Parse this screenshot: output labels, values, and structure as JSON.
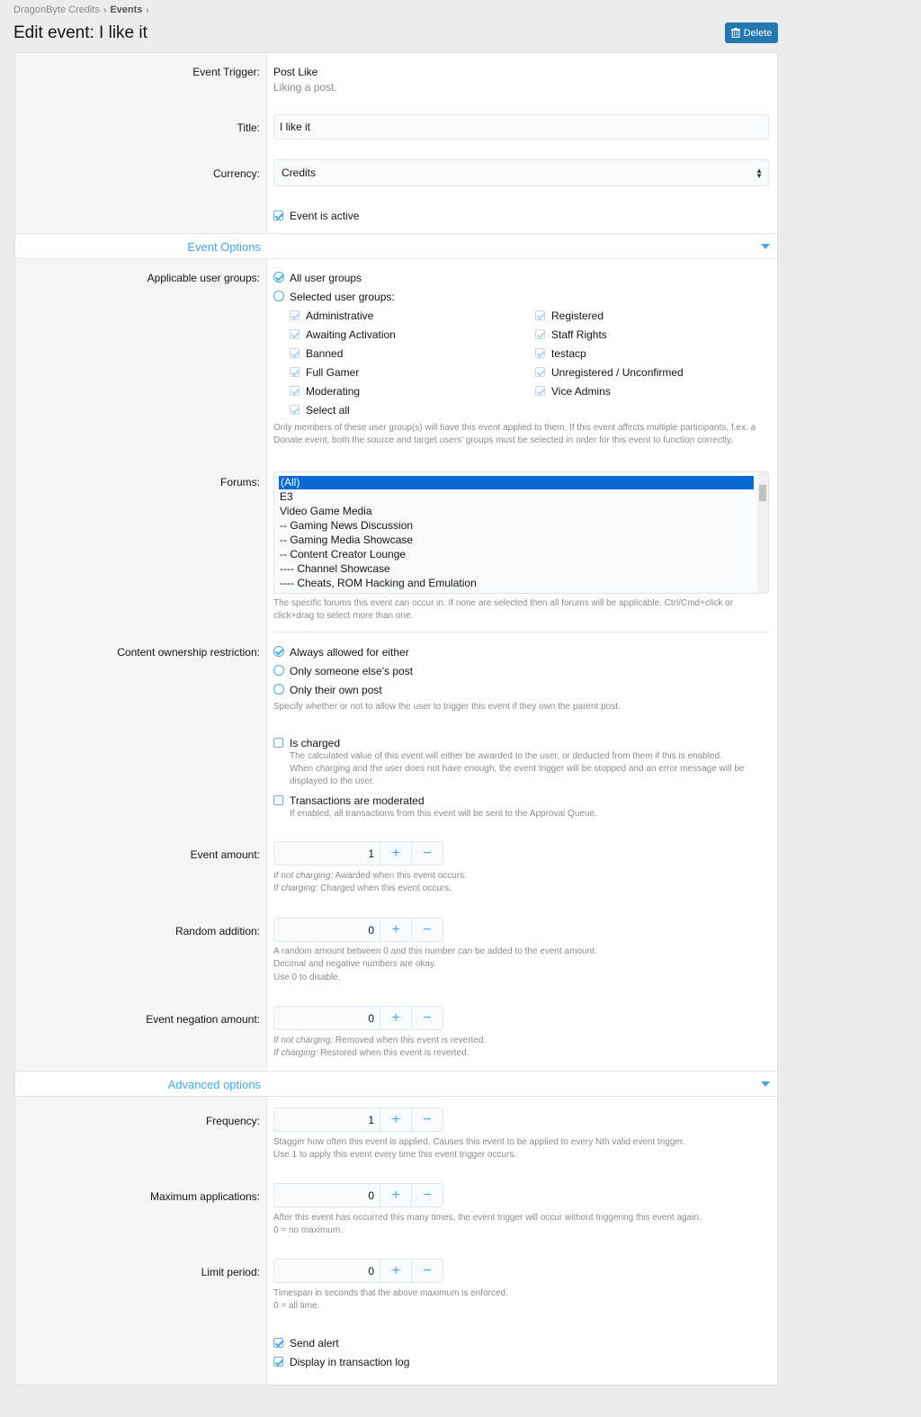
{
  "breadcrumb": {
    "root": "DragonByte Credits",
    "current": "Events"
  },
  "page_title": "Edit event: I like it",
  "delete_label": "Delete",
  "event_trigger": {
    "label": "Event Trigger:",
    "value": "Post Like",
    "desc": "Liking a post."
  },
  "title": {
    "label": "Title:",
    "value": "I like it"
  },
  "currency": {
    "label": "Currency:",
    "value": "Credits"
  },
  "event_active": {
    "label": "Event is active",
    "checked": true
  },
  "section_event_options": "Event Options",
  "user_groups": {
    "label": "Applicable user groups:",
    "all_label": "All user groups",
    "selected_label": "Selected user groups:",
    "col1": [
      "Administrative",
      "Awaiting Activation",
      "Banned",
      "Full Gamer",
      "Moderating",
      "Select all"
    ],
    "col2": [
      "Registered",
      "Staff Rights",
      "testacp",
      "Unregistered / Unconfirmed",
      "Vice Admins"
    ],
    "hint1": "Only members of these user group(s) will have this event applied to them. If this event affects multiple participants, f.ex. a",
    "hint2": "Donate event, both the source and target users' groups must be selected in order for this event to function correctly."
  },
  "forums": {
    "label": "Forums:",
    "options": [
      "(All)",
      "E3",
      "Video Game Media",
      "-- Gaming News Discussion",
      "-- Gaming Media Showcase",
      "-- Content Creator Lounge",
      "---- Channel Showcase",
      "---- Cheats, ROM Hacking and Emulation"
    ],
    "selected": "(All)",
    "hint1": "The specific forums this event can occur in. If none are selected then all forums will be applicable. Ctrl/Cmd+click or",
    "hint2": "click+drag to select more than one."
  },
  "ownership": {
    "label": "Content ownership restriction:",
    "options": [
      "Always allowed for either",
      "Only someone else's post",
      "Only their own post"
    ],
    "selected": "Always allowed for either",
    "hint": "Specify whether or not to allow the user to trigger this event if they own the parent post."
  },
  "is_charged": {
    "label": "Is charged",
    "checked": false,
    "hint1": "The calculated value of this event will either be awarded to the user, or deducted from them if this is enabled.",
    "hint2": "When charging and the user does not have enough, the event trigger will be stopped and an error message will be",
    "hint3": "displayed to the user."
  },
  "moderated": {
    "label": "Transactions are moderated",
    "checked": false,
    "hint": "If enabled, all transactions from this event will be sent to the Approval Queue."
  },
  "event_amount": {
    "label": "Event amount:",
    "value": "1",
    "hint1_em": "If not charging:",
    "hint1": " Awarded when this event occurs.",
    "hint2_em": "If charging:",
    "hint2": " Charged when this event occurs."
  },
  "random_addition": {
    "label": "Random addition:",
    "value": "0",
    "hint1": "A random amount between 0 and this number can be added to the event amount.",
    "hint2": "Decimal and negative numbers are okay.",
    "hint3": "Use 0 to disable."
  },
  "negation_amount": {
    "label": "Event negation amount:",
    "value": "0",
    "hint1_em": "If not charging:",
    "hint1": " Removed when this event is reverted.",
    "hint2_em": "If charging:",
    "hint2": " Restored when this event is reverted."
  },
  "section_advanced": "Advanced options",
  "frequency": {
    "label": "Frequency:",
    "value": "1",
    "hint1": "Stagger how often this event is applied. Causes this event to be applied to every Nth valid event trigger.",
    "hint2": "Use 1 to apply this event every time this event trigger occurs."
  },
  "max_applications": {
    "label": "Maximum applications:",
    "value": "0",
    "hint1": "After this event has occurred this many times, the event trigger will occur without triggering this event again.",
    "hint2": "0 = no maximum."
  },
  "limit_period": {
    "label": "Limit period:",
    "value": "0",
    "hint1": "Timespan in seconds that the above maximum is enforced.",
    "hint2": "0 = all time."
  },
  "send_alert": {
    "label": "Send alert",
    "checked": true
  },
  "transaction_log": {
    "label": "Display in transaction log",
    "checked": true
  },
  "stepper_plus": "+",
  "stepper_minus": "−"
}
